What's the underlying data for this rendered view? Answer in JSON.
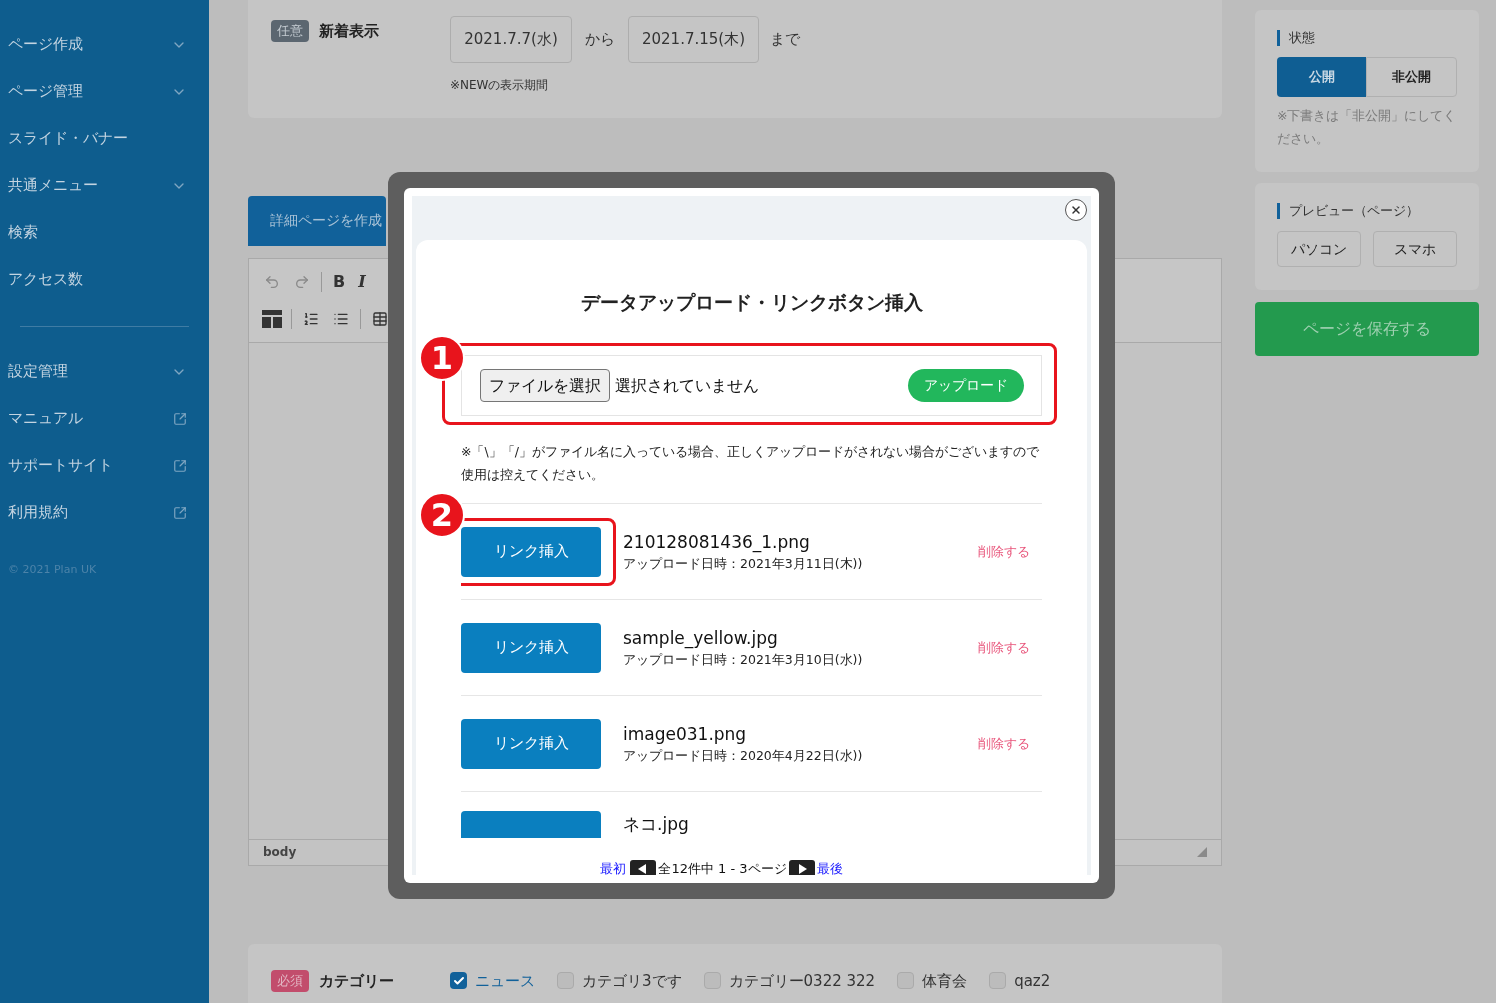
{
  "sidebar": {
    "groups": [
      {
        "items": [
          {
            "label": "ページ作成",
            "kind": "submenu"
          },
          {
            "label": "ページ管理",
            "kind": "submenu"
          },
          {
            "label": "スライド・バナー",
            "kind": "link"
          },
          {
            "label": "共通メニュー",
            "kind": "submenu"
          },
          {
            "label": "検索",
            "kind": "link"
          },
          {
            "label": "アクセス数",
            "kind": "link"
          }
        ]
      },
      {
        "items": [
          {
            "label": "設定管理",
            "kind": "submenu"
          },
          {
            "label": "マニュアル",
            "kind": "external"
          },
          {
            "label": "サポートサイト",
            "kind": "external"
          },
          {
            "label": "利用規約",
            "kind": "external"
          }
        ]
      }
    ],
    "copyright": "© 2021 Plan UK"
  },
  "news_display": {
    "badge": "任意",
    "label": "新着表示",
    "from": "2021.7.7(水)",
    "from_suffix": "から",
    "to": "2021.7.15(木)",
    "to_suffix": "まで",
    "note": "※NEWの表示期間"
  },
  "create_detail_button": "詳細ページを作成",
  "editor": {
    "toolbar_rows": [
      [
        {
          "kind": "undo"
        },
        {
          "kind": "redo"
        },
        {
          "kind": "separator"
        },
        {
          "kind": "bold",
          "label": "B"
        },
        {
          "kind": "italic",
          "label": "I"
        }
      ],
      [
        {
          "kind": "layout"
        },
        {
          "kind": "separator"
        },
        {
          "kind": "ordered_list"
        },
        {
          "kind": "bullet_list"
        },
        {
          "kind": "separator"
        },
        {
          "kind": "table"
        }
      ]
    ],
    "path": "body"
  },
  "status": {
    "title": "状態",
    "options": [
      {
        "label": "公開",
        "selected": true
      },
      {
        "label": "非公開",
        "selected": false
      }
    ],
    "note": "※下書きは「非公開」にしてください。"
  },
  "preview": {
    "title": "プレビュー（ページ）",
    "buttons": [
      "パソコン",
      "スマホ"
    ]
  },
  "save_button": "ページを保存する",
  "category": {
    "badge": "必須",
    "label": "カテゴリー",
    "options": [
      {
        "label": "ニュース",
        "checked": true
      },
      {
        "label": "カテゴリ3です",
        "checked": false
      },
      {
        "label": "カテゴリー0322 322",
        "checked": false
      },
      {
        "label": "体育会",
        "checked": false
      },
      {
        "label": "qaz2",
        "checked": false
      }
    ]
  },
  "modal": {
    "title": "データアップロード・リンクボタン挿入",
    "file_button": "ファイルを選択",
    "file_status": "選択されていません",
    "upload_button": "アップロード",
    "note": "※「\\」「/」がファイル名に入っている場合、正しくアップロードがされない場合がございますので使用は控えてください。",
    "files": [
      {
        "name": "210128081436_1.png",
        "uploaded": "アップロード日時：2021年3月11日(木))",
        "insert_button": "リンク挿入",
        "delete": "削除する"
      },
      {
        "name": "sample_yellow.jpg",
        "uploaded": "アップロード日時：2021年3月10日(水))",
        "insert_button": "リンク挿入",
        "delete": "削除する"
      },
      {
        "name": "image031.png",
        "uploaded": "アップロード日時：2020年4月22日(水))",
        "insert_button": "リンク挿入",
        "delete": "削除する"
      },
      {
        "name": "ネコ.jpg"
      }
    ],
    "pagination": {
      "first": "最初",
      "summary": "全12件中 1 - 3ページ",
      "last": "最後"
    },
    "callouts": [
      "1",
      "2"
    ]
  }
}
